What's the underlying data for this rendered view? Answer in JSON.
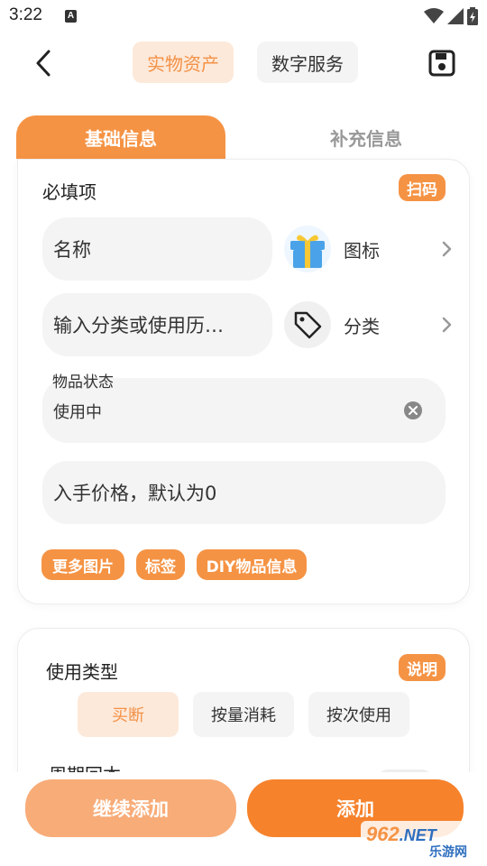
{
  "status_bar": {
    "time": "3:22",
    "notification_letter": "A"
  },
  "header": {
    "segments": [
      "实物资产",
      "数字服务"
    ],
    "active_segment": "实物资产"
  },
  "tabs": [
    {
      "label": "基础信息",
      "active": true
    },
    {
      "label": "补充信息",
      "active": false
    }
  ],
  "required_section": {
    "title": "必填项",
    "scan_label": "扫码",
    "name_placeholder": "名称",
    "icon_picker_label": "图标",
    "category_placeholder": "输入分类或使用历…",
    "category_picker_label": "分类",
    "status_label": "物品状态",
    "status_value": "使用中",
    "price_placeholder": "入手价格，默认为0",
    "chips": [
      "更多图片",
      "标签",
      "DIY物品信息"
    ]
  },
  "usage_section": {
    "title": "使用类型",
    "help_label": "说明",
    "options": [
      "买断",
      "按量消耗",
      "按次使用"
    ],
    "selected_option": "买断",
    "cycle_title": "周期回本"
  },
  "footer": {
    "continue_label": "继续添加",
    "add_label": "添加"
  },
  "watermark": {
    "brand_number": "962",
    "brand_suffix": ".NET",
    "site_name": "乐游网"
  },
  "colors": {
    "accent": "#f59344",
    "accent_light": "#fde9da",
    "accent_button": "#f6822b",
    "secondary_button": "#f8ac78",
    "field_bg": "#f4f4f4"
  }
}
